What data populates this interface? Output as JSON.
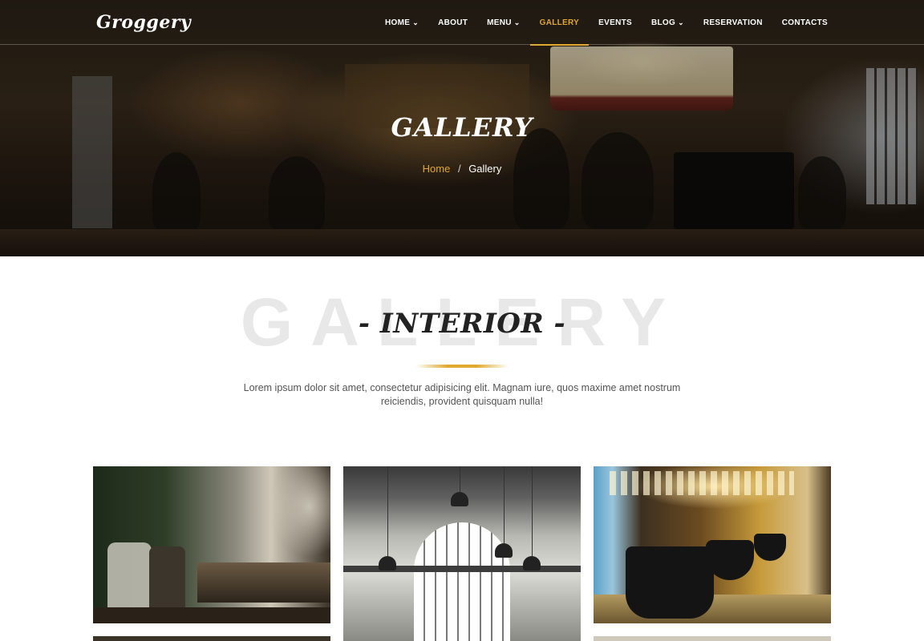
{
  "brand": {
    "logo": "Groggery"
  },
  "nav": {
    "items": [
      {
        "label": "HOME",
        "has_dropdown": true,
        "active": false
      },
      {
        "label": "ABOUT",
        "has_dropdown": false,
        "active": false
      },
      {
        "label": "MENU",
        "has_dropdown": true,
        "active": false
      },
      {
        "label": "GALLERY",
        "has_dropdown": false,
        "active": true
      },
      {
        "label": "EVENTS",
        "has_dropdown": false,
        "active": false
      },
      {
        "label": "BLOG",
        "has_dropdown": true,
        "active": false
      },
      {
        "label": "RESERVATION",
        "has_dropdown": false,
        "active": false
      },
      {
        "label": "CONTACTS",
        "has_dropdown": false,
        "active": false
      }
    ],
    "dropdown_icon": "chevron-down-icon"
  },
  "hero": {
    "title": "GALLERY",
    "breadcrumb": {
      "home": "Home",
      "separator": "/",
      "current": "Gallery"
    }
  },
  "section": {
    "background_word": "GALLERY",
    "title": "- INTERIOR -",
    "description": "Lorem ipsum dolor sit amet, consectetur adipisicing elit. Magnam iure, quos maxime amet nostrum reiciendis, provident quisquam nulla!"
  },
  "colors": {
    "accent": "#e0a82e",
    "heading": "#222222",
    "text": "#555555",
    "bg_word": "#e8e8e8"
  }
}
